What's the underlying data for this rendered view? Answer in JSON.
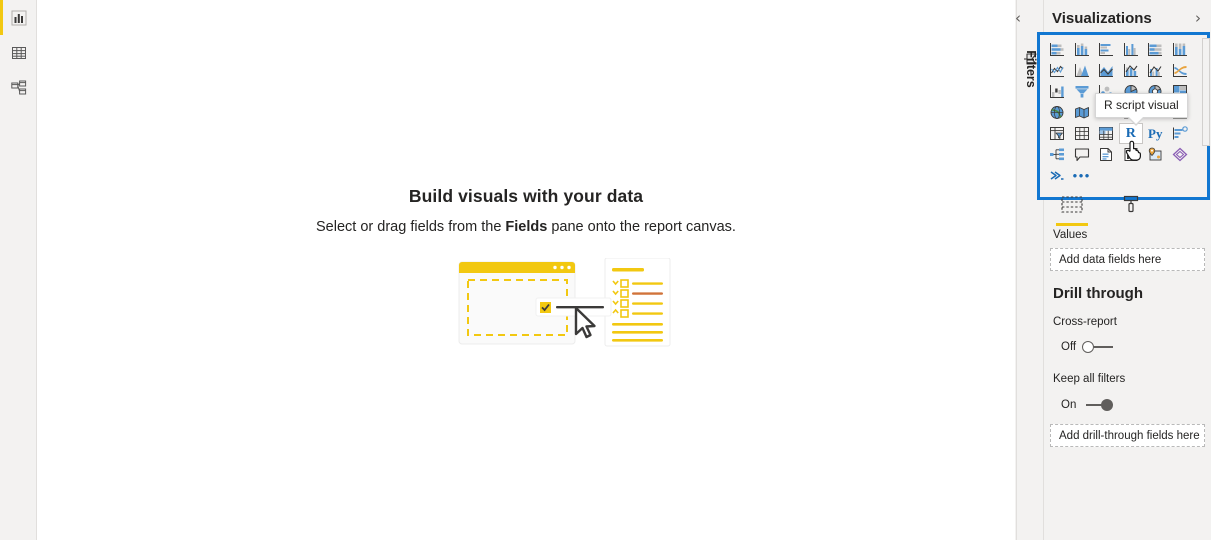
{
  "left_rail": {
    "items": [
      {
        "name": "report-view",
        "icon": "bar-chart-icon",
        "active": true
      },
      {
        "name": "data-view",
        "icon": "table-icon",
        "active": false
      },
      {
        "name": "model-view",
        "icon": "model-relationships-icon",
        "active": false
      }
    ]
  },
  "canvas": {
    "empty_state": {
      "title": "Build visuals with your data",
      "subtitle_before": "Select or drag fields from the ",
      "subtitle_bold": "Fields",
      "subtitle_after": " pane onto the report canvas.",
      "illustration_name": "drag-fields-illustration"
    }
  },
  "filters_pane": {
    "label": "Filters",
    "icon": "filter-funnel-icon",
    "collapsed": true
  },
  "visualizations_pane": {
    "title": "Visualizations",
    "collapse_chevron": "‹",
    "expand_chevron": "›",
    "gallery": {
      "highlighted": true,
      "highlight_color": "#1177d1",
      "selected_icon": "r-script-visual-icon",
      "icons": [
        "stacked-bar-chart-icon",
        "stacked-column-chart-icon",
        "clustered-bar-chart-icon",
        "clustered-column-chart-icon",
        "100-percent-stacked-bar-chart-icon",
        "100-percent-stacked-column-chart-icon",
        "line-chart-icon",
        "area-chart-icon",
        "stacked-area-chart-icon",
        "line-and-stacked-column-chart-icon",
        "line-and-clustered-column-chart-icon",
        "ribbon-chart-icon",
        "waterfall-chart-icon",
        "funnel-icon",
        "scatter-chart-icon",
        "pie-chart-icon",
        "donut-chart-icon",
        "treemap-icon",
        "map-icon",
        "filled-map-icon",
        "shape-map-icon",
        "azure-map-icon",
        "gauge-icon",
        "card-icon",
        "multi-row-card-icon",
        "kpi-icon",
        "slicer-icon",
        "table-icon",
        "matrix-icon",
        "r-script-visual-icon",
        "python-visual-icon",
        "key-influencers-icon",
        "decomposition-tree-icon",
        "q-and-a-icon",
        "smart-narrative-icon",
        "paginated-report-icon",
        "arcgis-map-icon",
        "power-apps-icon",
        "power-automate-icon",
        "get-more-visuals-icon"
      ]
    },
    "tooltip": {
      "text": "R script visual",
      "visible": true
    },
    "cursor": "pointing-hand-cursor",
    "tabs": [
      {
        "name": "fields-tab",
        "icon": "fields-grid-icon",
        "active": true
      },
      {
        "name": "format-tab",
        "icon": "paint-roller-icon",
        "active": false
      }
    ],
    "values_section": {
      "label": "Values",
      "dropzone_placeholder": "Add data fields here"
    },
    "drill_through": {
      "heading": "Drill through",
      "cross_report": {
        "label": "Cross-report",
        "state": "Off",
        "on": false
      },
      "keep_all_filters": {
        "label": "Keep all filters",
        "state": "On",
        "on": true
      },
      "dropzone_placeholder": "Add drill-through fields here"
    }
  }
}
